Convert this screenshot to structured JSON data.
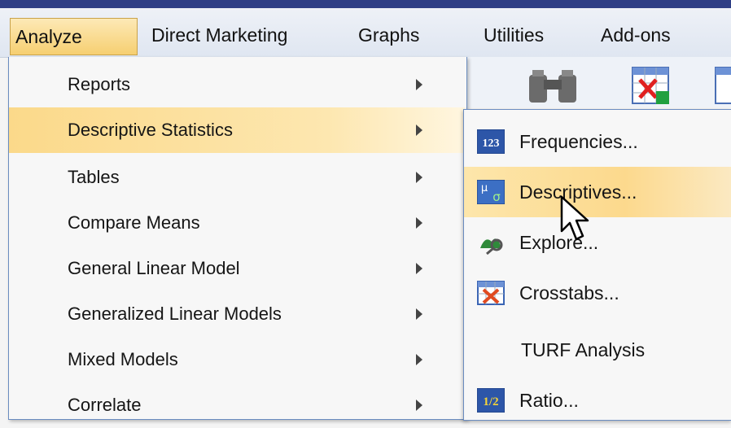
{
  "menubar": {
    "items": [
      {
        "label": "Analyze",
        "mnemonic": "A"
      },
      {
        "label": "Direct Marketing",
        "mnemonic": "M"
      },
      {
        "label": "Graphs",
        "mnemonic": "G"
      },
      {
        "label": "Utilities",
        "mnemonic": "U"
      },
      {
        "label": "Add-ons",
        "mnemonic": "o"
      }
    ]
  },
  "analyze_menu": {
    "items": [
      {
        "label": "Reports",
        "has_submenu": true
      },
      {
        "label": "Descriptive Statistics",
        "has_submenu": true,
        "highlighted": true
      },
      {
        "label": "Tables",
        "has_submenu": true
      },
      {
        "label": "Compare Means",
        "has_submenu": true
      },
      {
        "label": "General Linear Model",
        "has_submenu": true
      },
      {
        "label": "Generalized Linear Models",
        "has_submenu": true
      },
      {
        "label": "Mixed Models",
        "has_submenu": true
      },
      {
        "label": "Correlate",
        "has_submenu": true
      }
    ]
  },
  "descriptive_submenu": {
    "items": [
      {
        "label": "Frequencies...",
        "icon": "frequencies-icon",
        "icon_text": "123"
      },
      {
        "label": "Descriptives...",
        "icon": "descriptives-icon",
        "icon_text": "μσ",
        "highlighted": true
      },
      {
        "label": "Explore...",
        "icon": "explore-icon"
      },
      {
        "label": "Crosstabs...",
        "icon": "crosstabs-icon"
      },
      {
        "label": "TURF Analysis",
        "icon": ""
      },
      {
        "label": "Ratio...",
        "icon": "ratio-icon",
        "icon_text": "1/2"
      }
    ]
  },
  "colors": {
    "highlight": "#fbd98a",
    "menu_border": "#6a8cc0",
    "top_border": "#2f3f86"
  }
}
